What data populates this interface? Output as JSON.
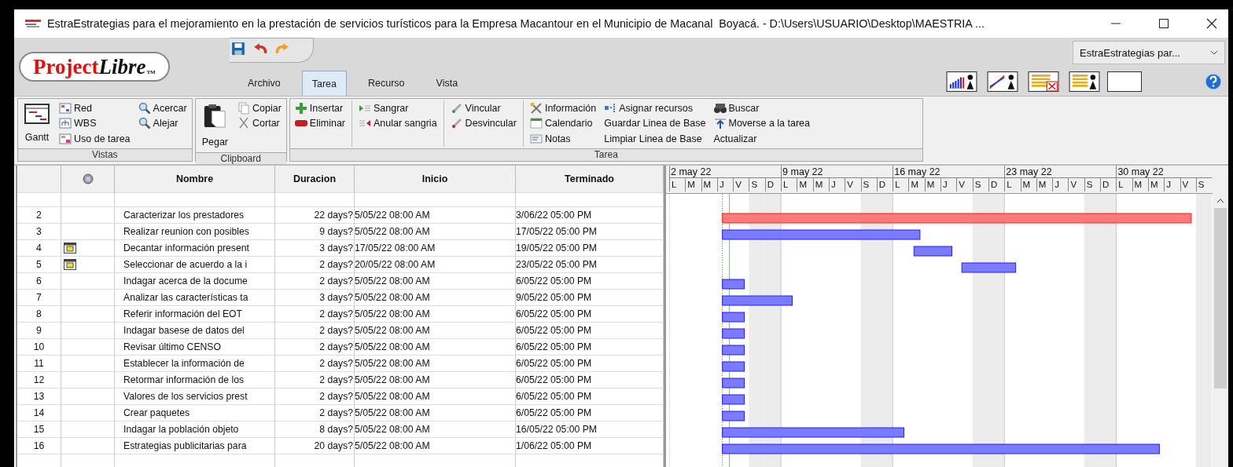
{
  "window": {
    "title": "EstraEstrategias para el mejoramiento en la prestación de servicios turísticos para la Empresa Macantour en el Municipio de Macanal  Boyacá. - D:\\Users\\USUARIO\\Desktop\\MAESTRIA ..."
  },
  "logo": {
    "primary": "Project",
    "secondary": "Libre",
    "mark": "TM"
  },
  "project_selector": {
    "value": "EstraEstrategias par..."
  },
  "menu_tabs": [
    {
      "label": "Archivo",
      "selected": false
    },
    {
      "label": "Tarea",
      "selected": true
    },
    {
      "label": "Recurso",
      "selected": false
    },
    {
      "label": "Vista",
      "selected": false
    }
  ],
  "ribbon": {
    "groups": [
      {
        "label": "Vistas",
        "columns": [
          [
            {
              "label": "Gantt",
              "kind": "large"
            }
          ],
          [
            {
              "label": "Red",
              "kind": "small"
            },
            {
              "label": "WBS",
              "kind": "small"
            },
            {
              "label": "Uso de tarea",
              "kind": "small"
            }
          ],
          [
            {
              "label": "Acercar",
              "kind": "small"
            },
            {
              "label": "Alejar",
              "kind": "small"
            }
          ]
        ]
      },
      {
        "label": "Clipboard",
        "columns": [
          [
            {
              "label": "Pegar",
              "kind": "large"
            }
          ],
          [
            {
              "label": "Copiar",
              "kind": "small"
            },
            {
              "label": "Cortar",
              "kind": "small"
            }
          ]
        ]
      },
      {
        "label": "Tarea",
        "columns": [
          [
            {
              "label": "Insertar",
              "kind": "small"
            },
            {
              "label": "Eliminar",
              "kind": "small"
            }
          ],
          [
            {
              "label": "Sangrar",
              "kind": "small"
            },
            {
              "label": "Anular sangria",
              "kind": "small"
            }
          ],
          [
            {
              "label": "Vincular",
              "kind": "small"
            },
            {
              "label": "Desvincular",
              "kind": "small"
            }
          ],
          [
            {
              "label": "Información",
              "kind": "small"
            },
            {
              "label": "Calendario",
              "kind": "small"
            },
            {
              "label": "Notas",
              "kind": "small"
            }
          ],
          [
            {
              "label": "Asignar recursos",
              "kind": "small"
            },
            {
              "label": "Guardar Linea de Base",
              "kind": "plain"
            },
            {
              "label": "Limpiar Linea de Base",
              "kind": "plain"
            }
          ],
          [
            {
              "label": "Buscar",
              "kind": "small"
            },
            {
              "label": "Moverse a la tarea",
              "kind": "small"
            },
            {
              "label": "Actualizar",
              "kind": "plain"
            }
          ]
        ]
      }
    ]
  },
  "table": {
    "columns": [
      "Nombre",
      "Duracion",
      "Inicio",
      "Terminado"
    ],
    "rows": [
      {
        "id": "2",
        "indicator": false,
        "name": "Caracterizar los prestadores",
        "duration": "22 days?",
        "start": "5/05/22 08:00 AM",
        "finish": "3/06/22 05:00 PM",
        "critical": true
      },
      {
        "id": "3",
        "indicator": false,
        "name": "Realizar reunion con posibles",
        "duration": "9 days?",
        "start": "5/05/22 08:00 AM",
        "finish": "17/05/22 05:00 PM",
        "critical": false
      },
      {
        "id": "4",
        "indicator": true,
        "name": "Decantar información present",
        "duration": "3 days?",
        "start": "17/05/22 08:00 AM",
        "finish": "19/05/22 05:00 PM",
        "critical": false
      },
      {
        "id": "5",
        "indicator": true,
        "name": "Seleccionar de acuerdo a la i",
        "duration": "2 days?",
        "start": "20/05/22 08:00 AM",
        "finish": "23/05/22 05:00 PM",
        "critical": false
      },
      {
        "id": "6",
        "indicator": false,
        "name": "Indagar acerca de la docume",
        "duration": "2 days?",
        "start": "5/05/22 08:00 AM",
        "finish": "6/05/22 05:00 PM",
        "critical": false
      },
      {
        "id": "7",
        "indicator": false,
        "name": "Analizar las características ta",
        "duration": "3 days?",
        "start": "5/05/22 08:00 AM",
        "finish": "9/05/22 05:00 PM",
        "critical": false
      },
      {
        "id": "8",
        "indicator": false,
        "name": "Referir información del EOT",
        "duration": "2 days?",
        "start": "5/05/22 08:00 AM",
        "finish": "6/05/22 05:00 PM",
        "critical": false
      },
      {
        "id": "9",
        "indicator": false,
        "name": "Indagar basese de datos del",
        "duration": "2 days?",
        "start": "5/05/22 08:00 AM",
        "finish": "6/05/22 05:00 PM",
        "critical": false
      },
      {
        "id": "10",
        "indicator": false,
        "name": "Revisar último CENSO",
        "duration": "2 days?",
        "start": "5/05/22 08:00 AM",
        "finish": "6/05/22 05:00 PM",
        "critical": false
      },
      {
        "id": "11",
        "indicator": false,
        "name": "Establecer la información de",
        "duration": "2 days?",
        "start": "5/05/22 08:00 AM",
        "finish": "6/05/22 05:00 PM",
        "critical": false
      },
      {
        "id": "12",
        "indicator": false,
        "name": "Retormar información de los",
        "duration": "2 days?",
        "start": "5/05/22 08:00 AM",
        "finish": "6/05/22 05:00 PM",
        "critical": false
      },
      {
        "id": "13",
        "indicator": false,
        "name": "Valores de los servicios prest",
        "duration": "2 days?",
        "start": "5/05/22 08:00 AM",
        "finish": "6/05/22 05:00 PM",
        "critical": false
      },
      {
        "id": "14",
        "indicator": false,
        "name": "Crear paquetes",
        "duration": "2 days?",
        "start": "5/05/22 08:00 AM",
        "finish": "6/05/22 05:00 PM",
        "critical": false
      },
      {
        "id": "15",
        "indicator": false,
        "name": "Indagar la población objeto",
        "duration": "8 days?",
        "start": "5/05/22 08:00 AM",
        "finish": "16/05/22 05:00 PM",
        "critical": false
      },
      {
        "id": "16",
        "indicator": false,
        "name": "Estrategias publicitarias para",
        "duration": "20 days?",
        "start": "5/05/22 08:00 AM",
        "finish": "1/06/22 05:00 PM",
        "critical": false
      }
    ]
  },
  "timescale": {
    "weeks": [
      {
        "label": "2 may 22",
        "days": [
          "L",
          "M",
          "M",
          "J",
          "V",
          "S",
          "D"
        ]
      },
      {
        "label": "9 may 22",
        "days": [
          "L",
          "M",
          "M",
          "J",
          "V",
          "S",
          "D"
        ]
      },
      {
        "label": "16 may 22",
        "days": [
          "L",
          "M",
          "M",
          "J",
          "V",
          "S",
          "D"
        ]
      },
      {
        "label": "23 may 22",
        "days": [
          "L",
          "M",
          "M",
          "J",
          "V",
          "S",
          "D"
        ]
      },
      {
        "label": "30 may 22",
        "days": [
          "L",
          "M",
          "M",
          "J",
          "V",
          "S"
        ]
      }
    ]
  }
}
